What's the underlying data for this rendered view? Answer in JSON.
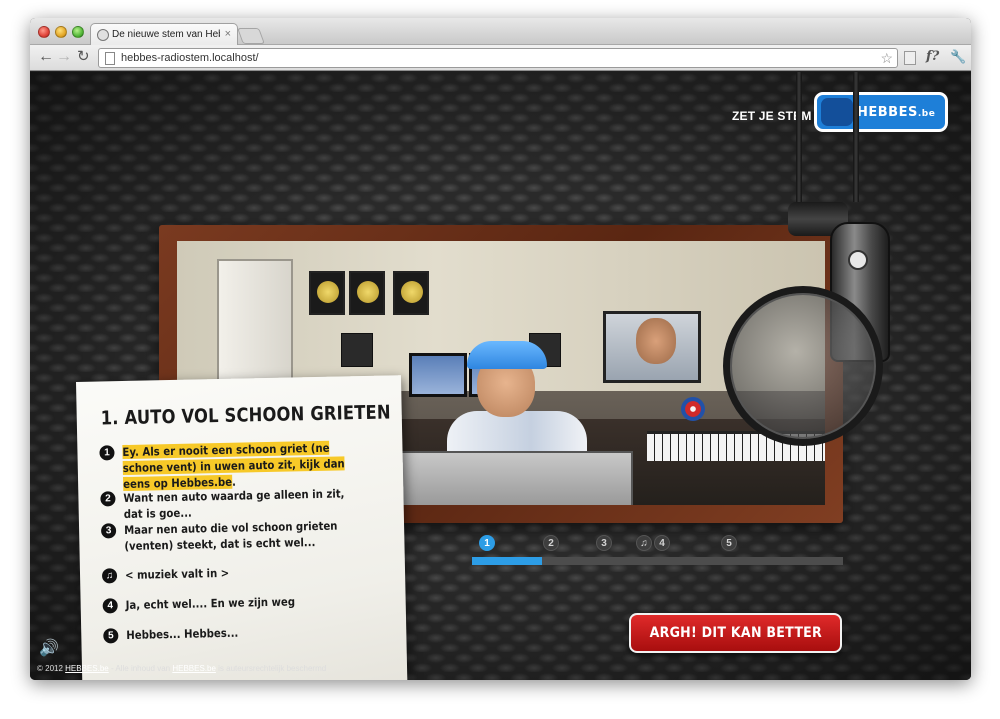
{
  "browser": {
    "tab_title": "De nieuwe stem van Hebbes",
    "tab_close": "×",
    "url": "hebbes-radiostem.localhost/",
    "star": "☆",
    "back": "←",
    "forward": "→",
    "reload": "↻",
    "fq": "f?",
    "wrench": "🔧"
  },
  "header": {
    "promo_text": "ZET JE STEM OP",
    "logo_text": "HEBBES",
    "logo_suffix": ".be"
  },
  "script": {
    "title": "1. AUTO VOL SCHOON GRIETEN",
    "lines": [
      {
        "num": "1",
        "text_highlight": "Ey. Als er nooit een schoon griet (ne schone vent) in uwen auto zit, kijk dan eens op Hebbes.be",
        "text_tail": "."
      },
      {
        "num": "2",
        "text": "Want nen auto waarda ge alleen in zit, dat is goe..."
      },
      {
        "num": "3",
        "text": "Maar nen auto die vol schoon grieten (venten) steekt, dat is echt wel..."
      },
      {
        "num": "♫",
        "text": "< muziek valt in >"
      },
      {
        "num": "4",
        "text": "Ja, echt wel.... En we zijn weg"
      },
      {
        "num": "5",
        "text": "Hebbes... Hebbes..."
      }
    ]
  },
  "progress": {
    "fraction": 0.19,
    "steps": [
      "1",
      "2",
      "3",
      "4",
      "5"
    ],
    "music_icon": "♫",
    "active_step": "1"
  },
  "cta": {
    "label": "ARGH! DIT KAN BETTER"
  },
  "footer": {
    "prefix": "© 2012 ",
    "brand1": "HEBBES.be",
    "middle": " - Alle inhoud van ",
    "brand2": "HEBBES.be",
    "suffix": " is auteursrechtelijk beschermd"
  },
  "sound_icon": "🔊",
  "colors": {
    "accent_blue": "#2d9de6",
    "highlight_yellow": "#f7c928",
    "cta_red": "#c41818",
    "logo_blue": "#1e7fd8"
  }
}
